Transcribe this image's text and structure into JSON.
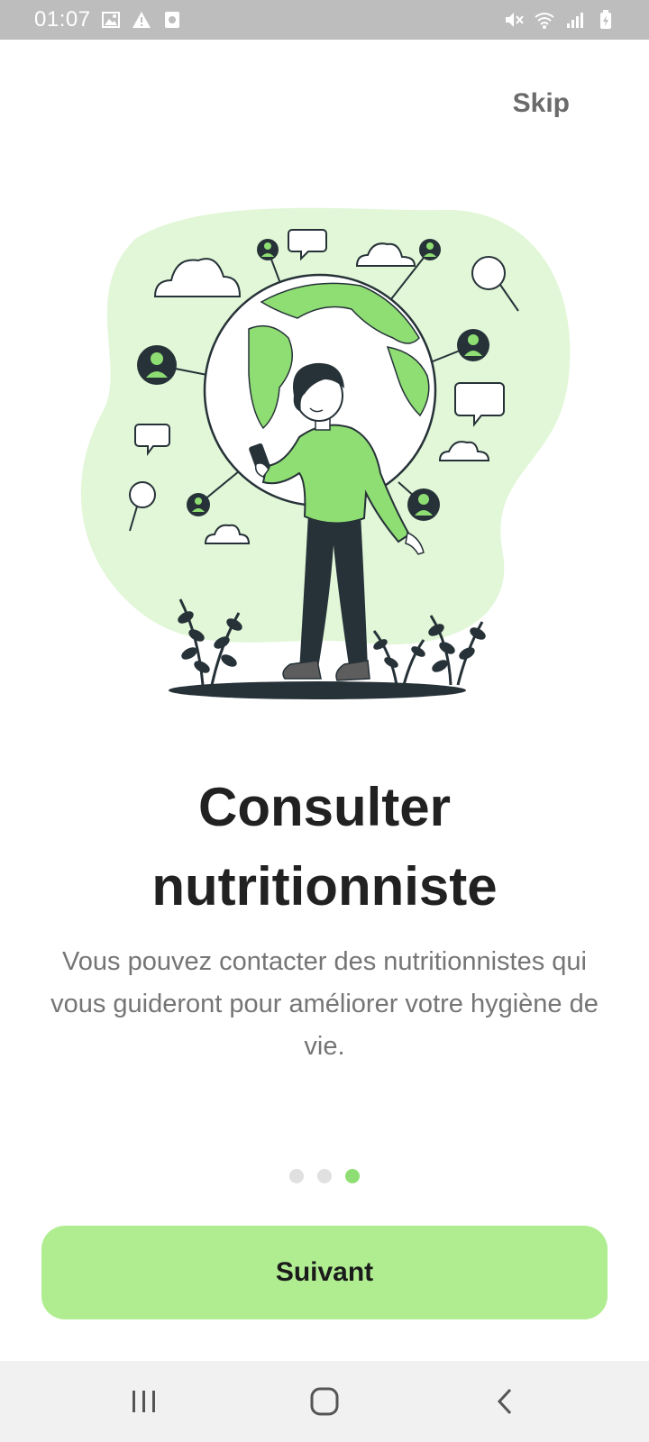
{
  "status_bar": {
    "time": "01:07",
    "left_icons": [
      "image-icon",
      "warning-icon",
      "app-notification-icon"
    ],
    "right_icons": [
      "mute-icon",
      "wifi-icon",
      "signal-icon",
      "battery-icon"
    ]
  },
  "header": {
    "skip_label": "Skip"
  },
  "onboarding": {
    "title": "Consulter nutritionniste",
    "description": "Vous pouvez contacter des nutritionnistes qui vous guideront pour améliorer votre hygiène de vie.",
    "page_count": 3,
    "current_page": 3
  },
  "actions": {
    "next_label": "Suivant"
  },
  "nav_bar": {
    "buttons": [
      "recent-apps-icon",
      "home-icon",
      "back-icon"
    ]
  },
  "colors": {
    "accent": "#8fde73",
    "button_bg": "#b0ed91",
    "blob": "#e1f7d7",
    "dark": "#263238",
    "status_bar": "#bdbdbd"
  }
}
